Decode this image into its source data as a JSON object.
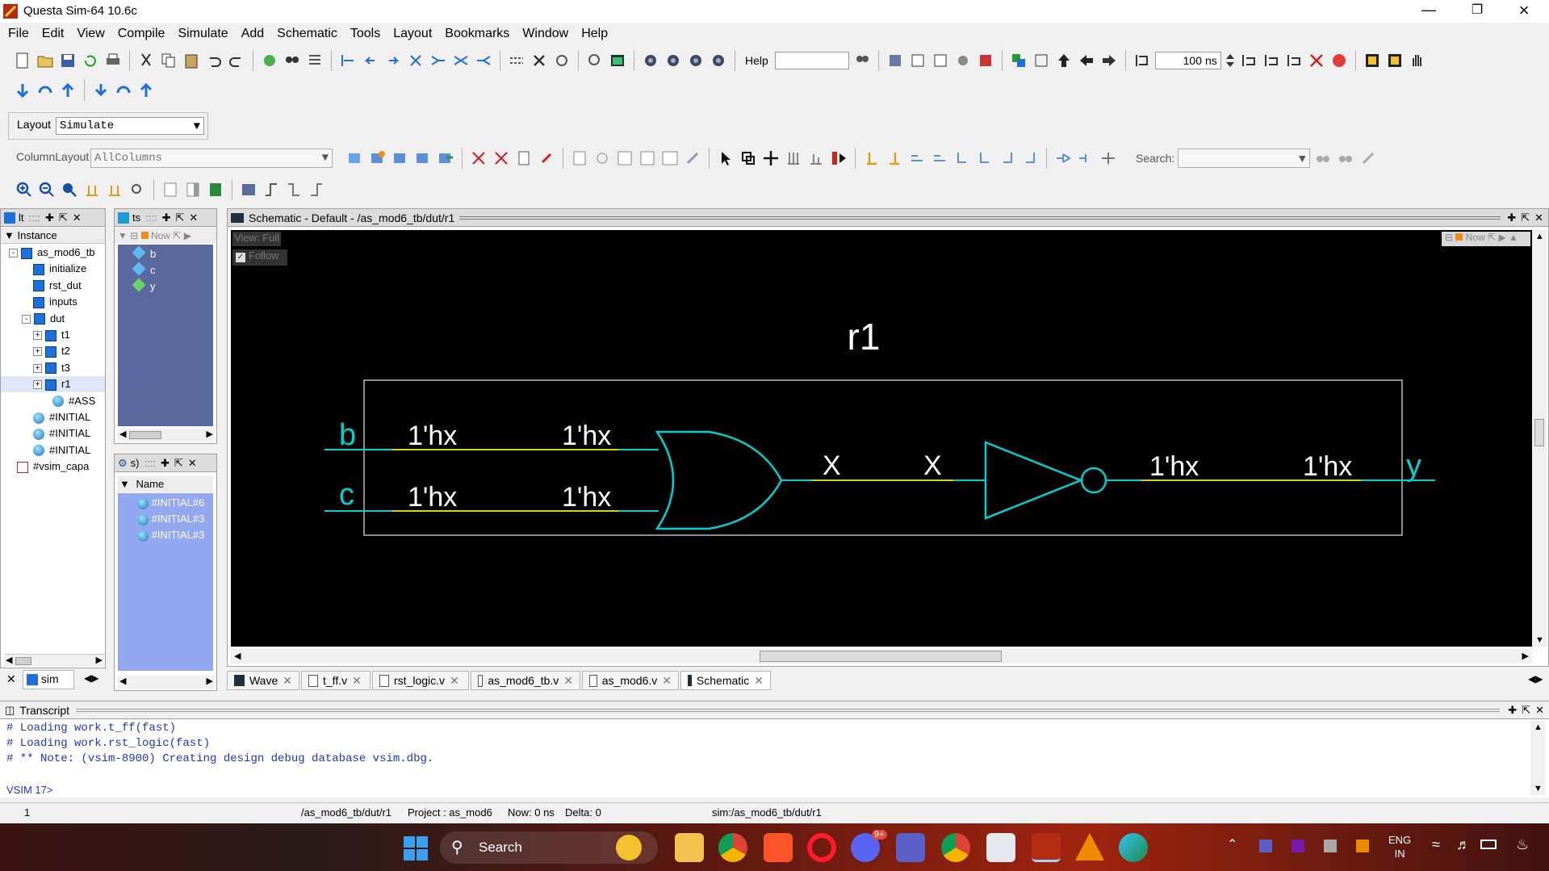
{
  "window": {
    "title": "Questa Sim-64 10.6c"
  },
  "menu": [
    "File",
    "Edit",
    "View",
    "Compile",
    "Simulate",
    "Add",
    "Schematic",
    "Tools",
    "Layout",
    "Bookmarks",
    "Window",
    "Help"
  ],
  "toolbar": {
    "help_label": "Help",
    "time_value": "100",
    "time_unit": "ns",
    "layout_label": "Layout",
    "layout_value": "Simulate",
    "columnlayout_label": "ColumnLayout",
    "columnlayout_value": "AllColumns",
    "search_label": "Search:"
  },
  "instance_panel": {
    "title": "lt",
    "header": "Instance",
    "tab": "sim",
    "items": [
      {
        "label": "as_mod6_tb",
        "kind": "sq"
      },
      {
        "label": "initialize",
        "kind": "sq"
      },
      {
        "label": "rst_dut",
        "kind": "sq"
      },
      {
        "label": "inputs",
        "kind": "sq"
      },
      {
        "label": "dut",
        "kind": "sq"
      },
      {
        "label": "t1",
        "kind": "sq"
      },
      {
        "label": "t2",
        "kind": "sq"
      },
      {
        "label": "t3",
        "kind": "sq"
      },
      {
        "label": "r1",
        "kind": "sq"
      },
      {
        "label": "#ASS",
        "kind": "ball"
      },
      {
        "label": "#INITIAL",
        "kind": "ball"
      },
      {
        "label": "#INITIAL",
        "kind": "ball"
      },
      {
        "label": "#INITIAL",
        "kind": "ball"
      },
      {
        "label": "#vsim_capa",
        "kind": "chart"
      }
    ]
  },
  "objects_panel": {
    "title": "ts",
    "now_label": "Now",
    "signals": [
      "b",
      "c",
      "y"
    ]
  },
  "processes_panel": {
    "title": "s)",
    "header": "Name",
    "items": [
      "#INITIAL#6",
      "#INITIAL#3",
      "#INITIAL#3"
    ]
  },
  "schematic": {
    "title": "Schematic - Default - /as_mod6_tb/dut/r1",
    "view_label": "View: Full",
    "follow_label": "Follow",
    "now_label": "Now",
    "block_name": "r1",
    "port_b": "b",
    "port_c": "c",
    "port_y": "y",
    "val_b1": "1'hx",
    "val_b2": "1'hx",
    "val_c1": "1'hx",
    "val_c2": "1'hx",
    "val_x1": "X",
    "val_x2": "X",
    "val_y1": "1'hx",
    "val_y2": "1'hx",
    "colors": {
      "wire": "#d8d800",
      "gate": "#00d0d0",
      "bg": "#000000"
    }
  },
  "tabs": [
    {
      "label": "Wave",
      "icon": "wave-icon"
    },
    {
      "label": "t_ff.v",
      "icon": "doc-icon"
    },
    {
      "label": "rst_logic.v",
      "icon": "doc-icon"
    },
    {
      "label": "as_mod6_tb.v",
      "icon": "doc-icon"
    },
    {
      "label": "as_mod6.v",
      "icon": "doc-icon"
    },
    {
      "label": "Schematic",
      "icon": "schematic-icon"
    }
  ],
  "transcript": {
    "title": "Transcript",
    "lines": [
      "# Loading work.t_ff(fast)",
      "# Loading work.rst_logic(fast)",
      "# ** Note: (vsim-8900) Creating design debug database vsim.dbg."
    ],
    "prompt": "VSIM 17>"
  },
  "status": {
    "line": "1",
    "path": "/as_mod6_tb/dut/r1",
    "project": "Project : as_mod6",
    "now": "Now: 0 ns",
    "delta": "Delta: 0",
    "sim": "sim:/as_mod6_tb/dut/r1"
  },
  "taskbar": {
    "search": "Search",
    "notif": "9+",
    "lang1": "ENG",
    "lang2": "IN"
  }
}
